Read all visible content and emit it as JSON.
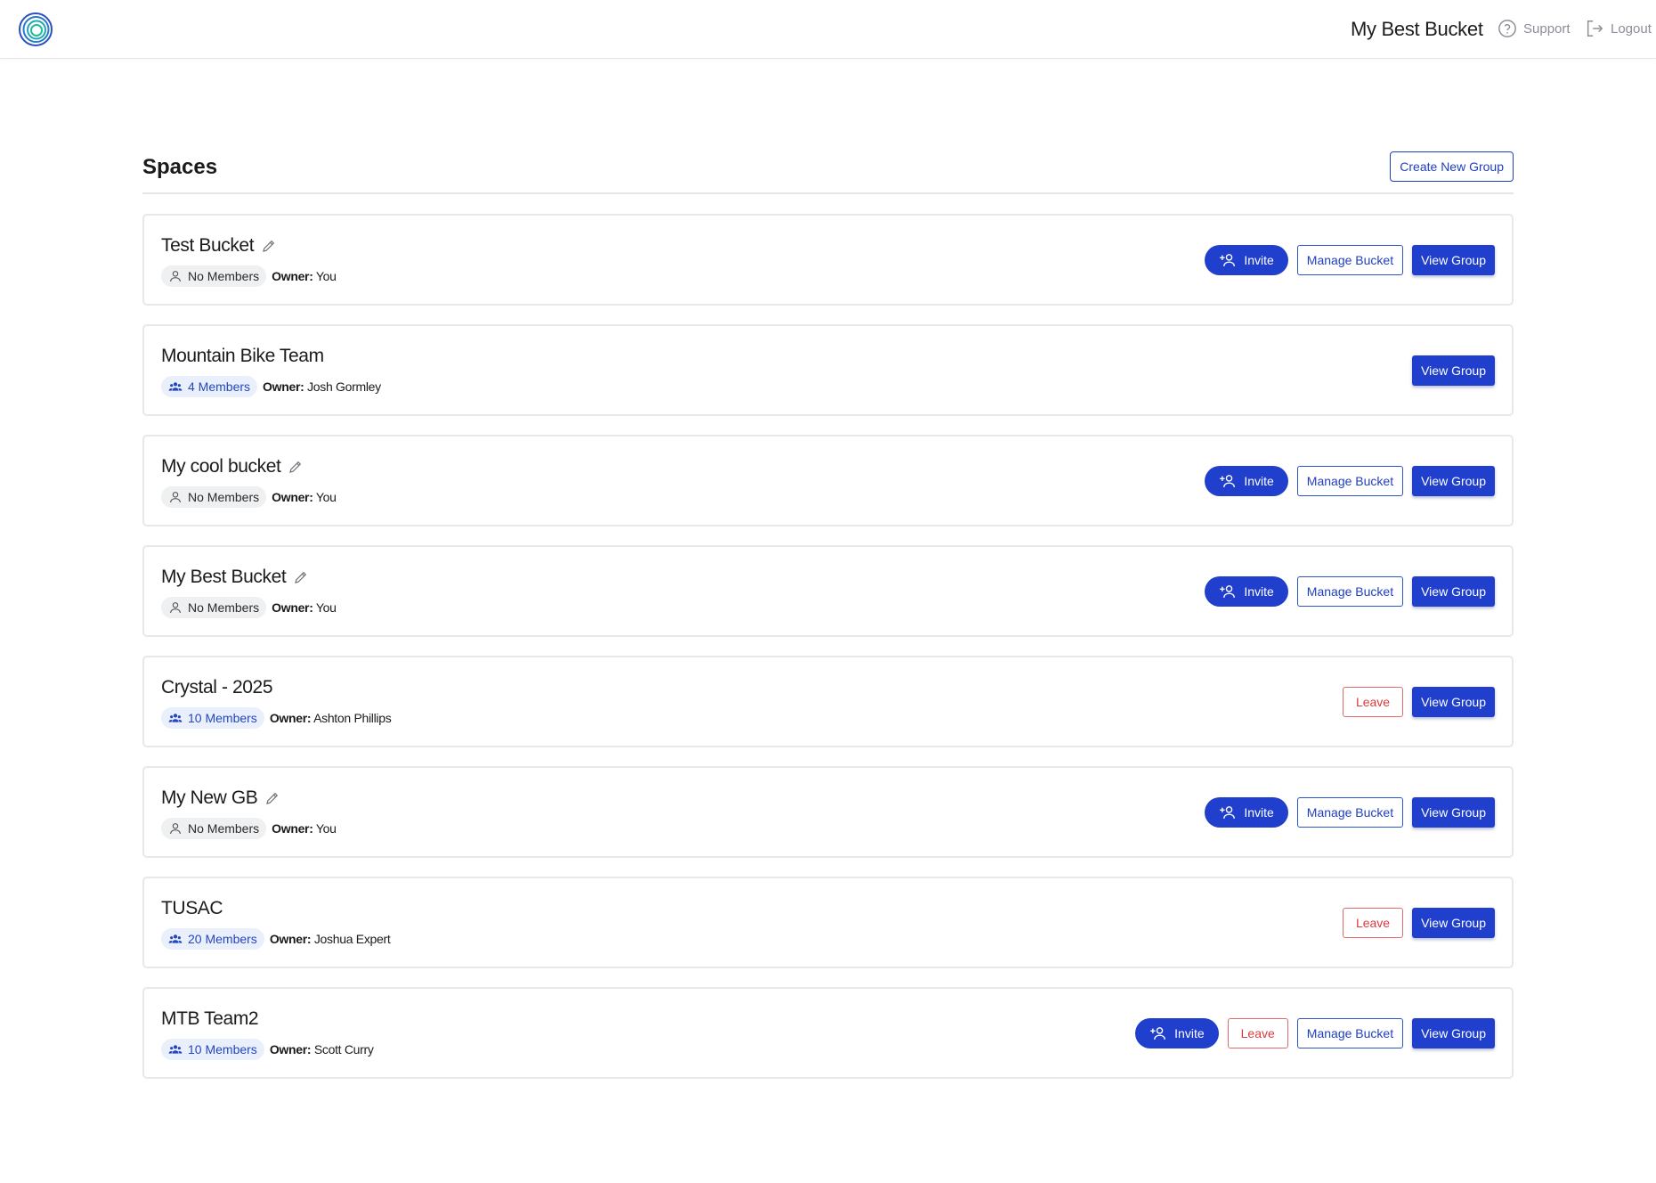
{
  "header": {
    "title": "My Best Bucket",
    "support_label": "Support",
    "logout_label": "Logout"
  },
  "spaces": {
    "title": "Spaces",
    "create_label": "Create New Group"
  },
  "buttons": {
    "invite": "Invite",
    "leave": "Leave",
    "manage": "Manage Bucket",
    "view": "View Group"
  },
  "owner_prefix": "Owner:",
  "groups": [
    {
      "name": "Test Bucket",
      "members": "No Members",
      "owner": "You"
    },
    {
      "name": "Mountain Bike Team",
      "members": "4 Members",
      "owner": "Josh Gormley"
    },
    {
      "name": "My cool bucket",
      "members": "No Members",
      "owner": "You"
    },
    {
      "name": "My Best Bucket",
      "members": "No Members",
      "owner": "You"
    },
    {
      "name": "Crystal - 2025",
      "members": "10 Members",
      "owner": "Ashton Phillips"
    },
    {
      "name": "My New GB",
      "members": "No Members",
      "owner": "You"
    },
    {
      "name": "TUSAC",
      "members": "20 Members",
      "owner": "Joshua Expert"
    },
    {
      "name": "MTB Team2",
      "members": "10 Members",
      "owner": "Scott Curry"
    }
  ],
  "colors": {
    "primary": "#1f3fcc",
    "danger": "#d93c3c",
    "member_badge_bg": "#eaf0fb",
    "empty_badge_bg": "#eef0f2"
  }
}
